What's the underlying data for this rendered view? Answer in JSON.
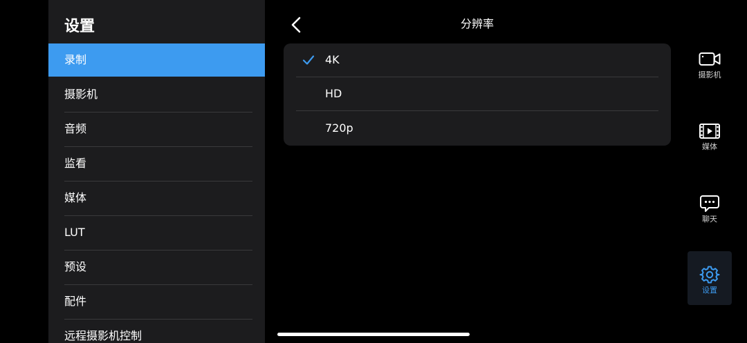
{
  "sidebar": {
    "title": "设置",
    "items": [
      {
        "label": "录制",
        "active": true
      },
      {
        "label": "摄影机",
        "active": false
      },
      {
        "label": "音频",
        "active": false
      },
      {
        "label": "监看",
        "active": false
      },
      {
        "label": "媒体",
        "active": false
      },
      {
        "label": "LUT",
        "active": false
      },
      {
        "label": "预设",
        "active": false
      },
      {
        "label": "配件",
        "active": false
      },
      {
        "label": "远程摄影机控制",
        "active": false
      }
    ]
  },
  "header": {
    "back_icon": "chevron-left-icon",
    "title": "分辨率"
  },
  "resolution": {
    "selected": "4K",
    "options": [
      {
        "label": "4K",
        "selected": true
      },
      {
        "label": "HD",
        "selected": false
      },
      {
        "label": "720p",
        "selected": false
      }
    ]
  },
  "tabbar": {
    "tabs": [
      {
        "label": "摄影机",
        "icon": "camera-icon",
        "active": false
      },
      {
        "label": "媒体",
        "icon": "film-icon",
        "active": false
      },
      {
        "label": "聊天",
        "icon": "chat-icon",
        "active": false
      },
      {
        "label": "设置",
        "icon": "gear-icon",
        "active": true
      }
    ]
  },
  "colors": {
    "accent": "#3d9bf0",
    "panel": "#1c1c1e",
    "background": "#000000",
    "separator": "#3a3a3c"
  }
}
